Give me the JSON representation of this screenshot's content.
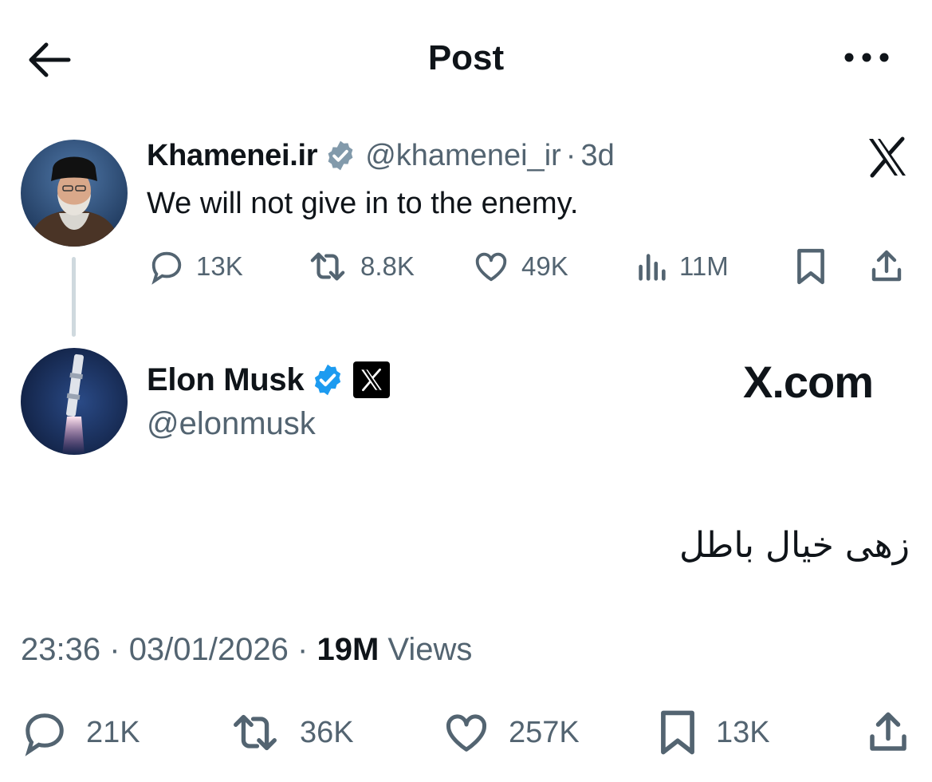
{
  "header": {
    "title": "Post",
    "back_icon": "arrow-left-icon",
    "more_icon": "more-horizontal-icon"
  },
  "quoted_post": {
    "display_name": "Khamenei.ir",
    "handle": "@khamenei_ir",
    "separator": "·",
    "time": "3d",
    "text": "We will not give in to the enemy.",
    "verified_badge_color": "#829aab",
    "stats": {
      "replies": "13K",
      "reposts": "8.8K",
      "likes": "49K",
      "views": "11M"
    }
  },
  "main_post": {
    "display_name": "Elon Musk",
    "handle": "@elonmusk",
    "verified_badge_color": "#1d9bf0",
    "brand_logo": "X.com",
    "text": "زهی خیال باطل",
    "meta": {
      "time": "23:36",
      "separator": "·",
      "date": "03/01/2026",
      "views_count": "19M",
      "views_label": "Views"
    },
    "stats": {
      "replies": "21K",
      "reposts": "36K",
      "likes": "257K",
      "bookmarks": "13K"
    }
  },
  "colors": {
    "text": "#0f1419",
    "muted": "#536471",
    "thread_line": "#cfd9de"
  }
}
